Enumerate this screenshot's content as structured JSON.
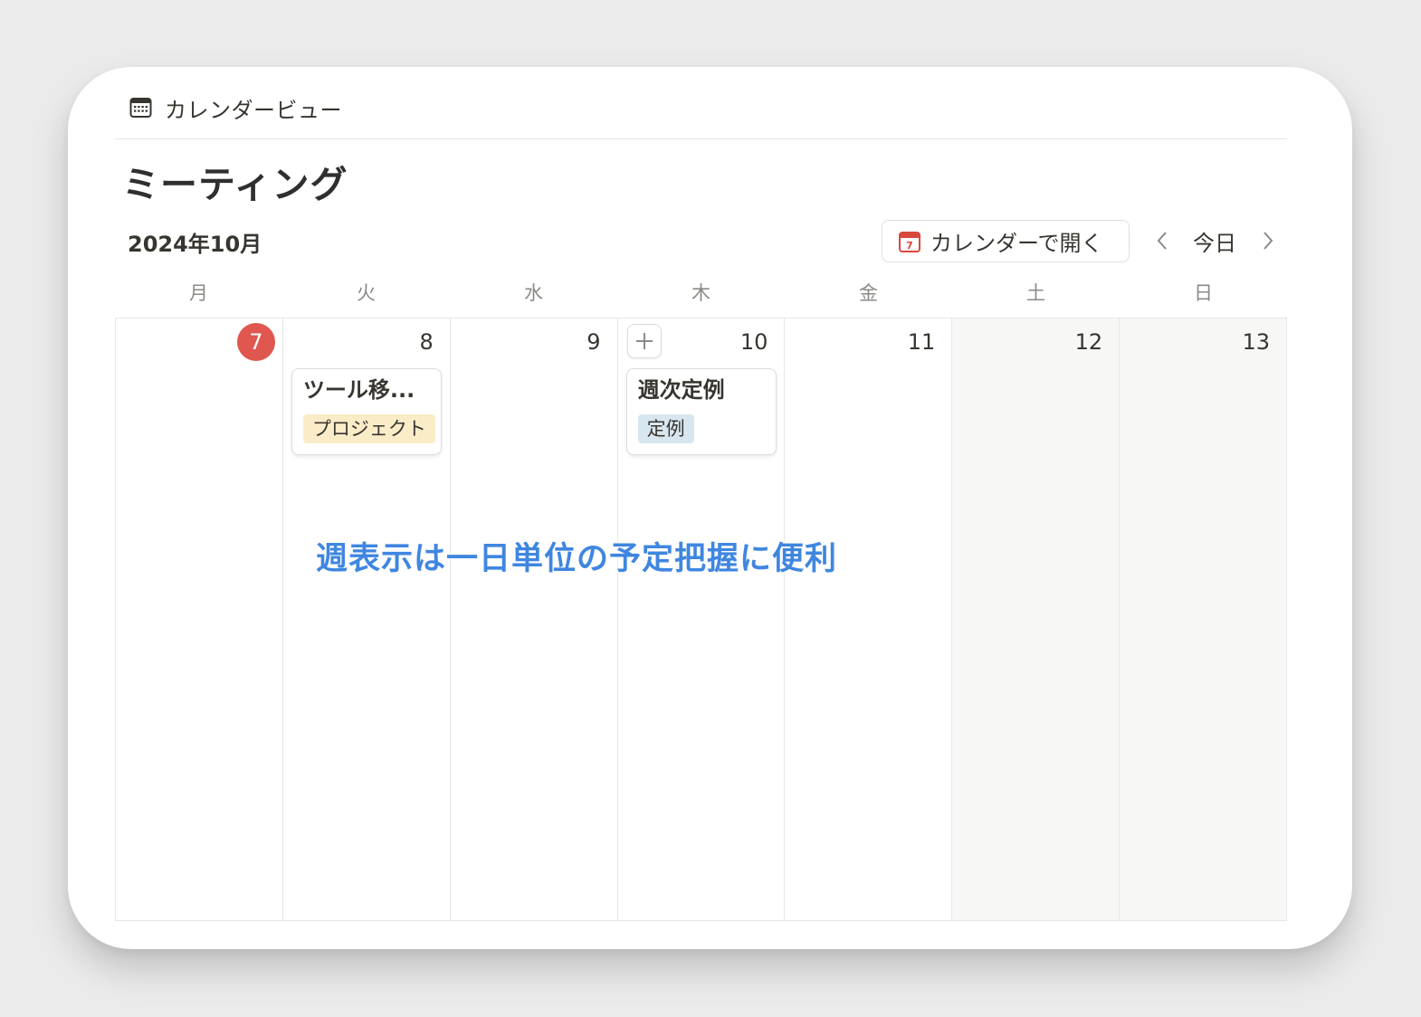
{
  "view": {
    "label": "カレンダービュー",
    "icon": "calendar-grid-icon"
  },
  "page": {
    "title": "ミーティング"
  },
  "toolbar": {
    "month": "2024年10月",
    "open_calendar_label": "カレンダーで開く",
    "open_calendar_icon": "calendar-app-icon",
    "today_label": "今日",
    "prev_icon": "chevron-left-icon",
    "next_icon": "chevron-right-icon"
  },
  "weekdays": [
    "月",
    "火",
    "水",
    "木",
    "金",
    "土",
    "日"
  ],
  "days": [
    {
      "number": "7",
      "today": true
    },
    {
      "number": "8"
    },
    {
      "number": "9"
    },
    {
      "number": "10"
    },
    {
      "number": "11"
    },
    {
      "number": "12",
      "weekend": true
    },
    {
      "number": "13",
      "weekend": true
    }
  ],
  "events": [
    {
      "title": "ツール移...",
      "tag": "プロジェクト",
      "tag_color": "#fbecc8"
    },
    {
      "title": "週次定例",
      "tag": "定例",
      "tag_color": "#d8e6f0"
    }
  ],
  "caption": "週表示は一日単位の予定把握に便利",
  "colors": {
    "today": "#e0574f",
    "caption": "#3f86e0",
    "weekend_bg": "#f7f7f5",
    "calendar_icon": "#d8483c"
  }
}
